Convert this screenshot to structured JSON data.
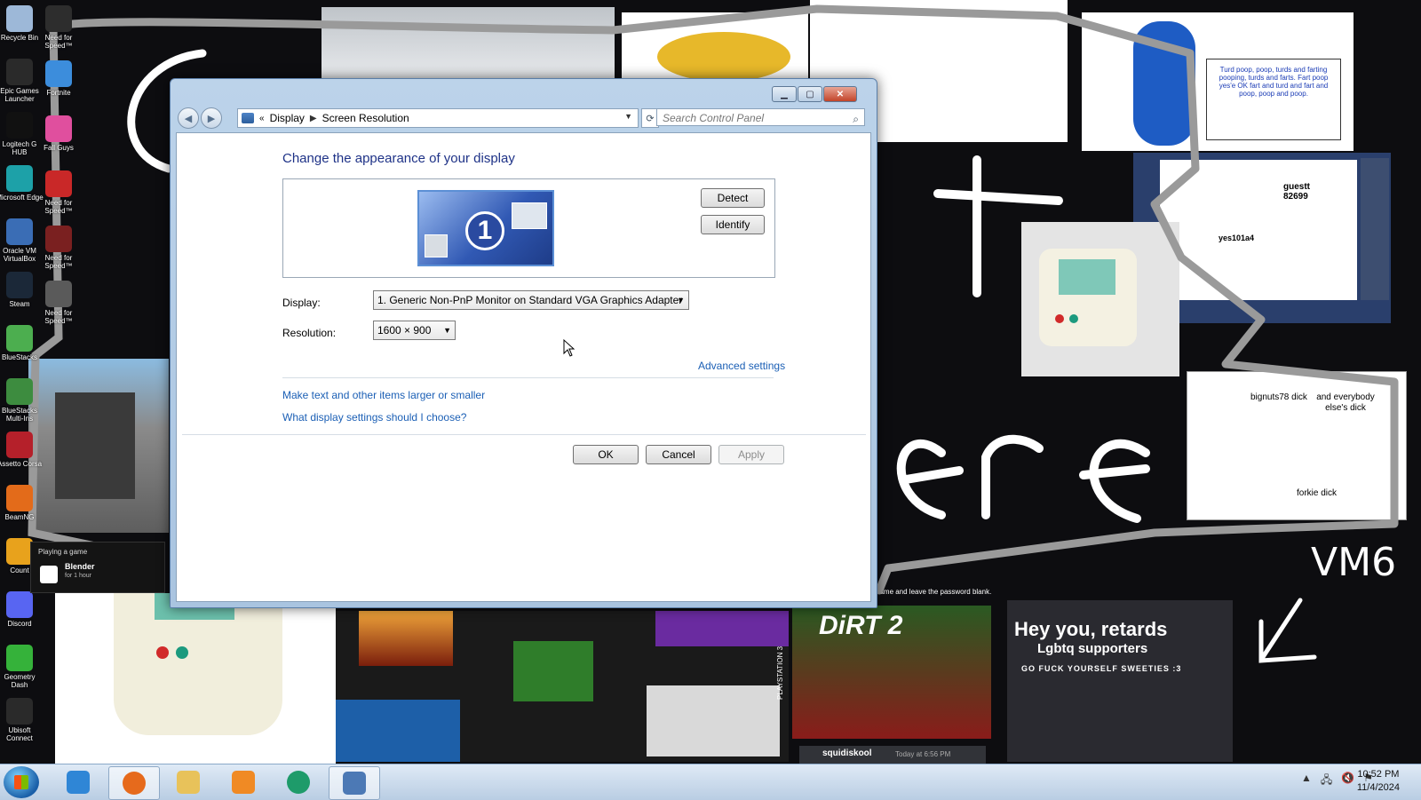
{
  "desktop": {
    "icons": [
      {
        "label": "Recycle Bin",
        "color": "#9db8d8"
      },
      {
        "label": "Epic Games Launcher",
        "color": "#2a2a2a"
      },
      {
        "label": "Logitech G HUB",
        "color": "#111111"
      },
      {
        "label": "Microsoft Edge",
        "color": "#1da1a8"
      },
      {
        "label": "Oracle VM VirtualBox",
        "color": "#3a6db5"
      },
      {
        "label": "Steam",
        "color": "#1b2838"
      },
      {
        "label": "BlueStacks",
        "color": "#4cae4f"
      },
      {
        "label": "BlueStacks Multi-Ins",
        "color": "#3d8c3f"
      },
      {
        "label": "Assetto Corsa",
        "color": "#b5202a"
      },
      {
        "label": "BeamNG",
        "color": "#e36b1a"
      },
      {
        "label": "Count",
        "color": "#e8a21c"
      },
      {
        "label": "Discord",
        "color": "#5865f2"
      },
      {
        "label": "Geometry Dash",
        "color": "#35b23a"
      },
      {
        "label": "Ubisoft Connect",
        "color": "#2a2a2a"
      }
    ],
    "icons_col2": [
      {
        "label": "Need for Speed™",
        "color": "#2d2d2d"
      },
      {
        "label": "Fortnite",
        "color": "#3c8ddc"
      },
      {
        "label": "Fall Guys",
        "color": "#e04f9e"
      },
      {
        "label": "Need for Speed™",
        "color": "#c92828"
      },
      {
        "label": "Need for Speed™",
        "color": "#7a2020"
      },
      {
        "label": "Need for Speed™",
        "color": "#5a5a5a"
      }
    ],
    "game_tile": {
      "heading": "Playing a game",
      "name": "Blender",
      "duration": "for 1 hour"
    },
    "notes": {
      "guest": "guestt",
      "guest_num": "82699",
      "yes": "yes101a4",
      "biggnuts": "bignuts78 dick",
      "everybody": "and everybody else's dick",
      "forkie": "forkie dick",
      "vm": "VM6",
      "hey": "Hey you, retards",
      "lgbtq": "Lgbtq supporters",
      "go": "GO FUCK YOURSELF SWEETIES :3",
      "squid": "squidiskool",
      "squid_time": "Today at 6:56 PM",
      "password": "name and leave the password blank.",
      "dirt": "DiRT 2",
      "ps": "PLAYSTATION 3",
      "sign": "Turd poop, poop, turds and farting pooping, turds and farts. Fart poop yes'e OK fart and turd and fart and poop, poop and poop."
    }
  },
  "window": {
    "breadcrumb_display": "Display",
    "breadcrumb_page": "Screen Resolution",
    "search_placeholder": "Search Control Panel",
    "heading": "Change the appearance of your display",
    "monitor_number": "1",
    "detect_label": "Detect",
    "identify_label": "Identify",
    "display_label": "Display:",
    "display_value": "1. Generic Non-PnP Monitor on Standard VGA Graphics Adapter",
    "resolution_label": "Resolution:",
    "resolution_value": "1600 × 900",
    "advanced_link": "Advanced settings",
    "link_text_size": "Make text and other items larger or smaller",
    "link_which_settings": "What display settings should I choose?",
    "ok_label": "OK",
    "cancel_label": "Cancel",
    "apply_label": "Apply"
  },
  "taskbar": {
    "items": [
      {
        "name": "internet-explorer",
        "color": "#2f86d6"
      },
      {
        "name": "firefox",
        "color": "#e66a1c"
      },
      {
        "name": "file-explorer",
        "color": "#e8c25a"
      },
      {
        "name": "media-player",
        "color": "#f08a24"
      },
      {
        "name": "app-green",
        "color": "#1e9b6a"
      },
      {
        "name": "control-panel",
        "color": "#4c79b5"
      }
    ],
    "time": "10:52 PM",
    "date": "11/4/2024"
  }
}
